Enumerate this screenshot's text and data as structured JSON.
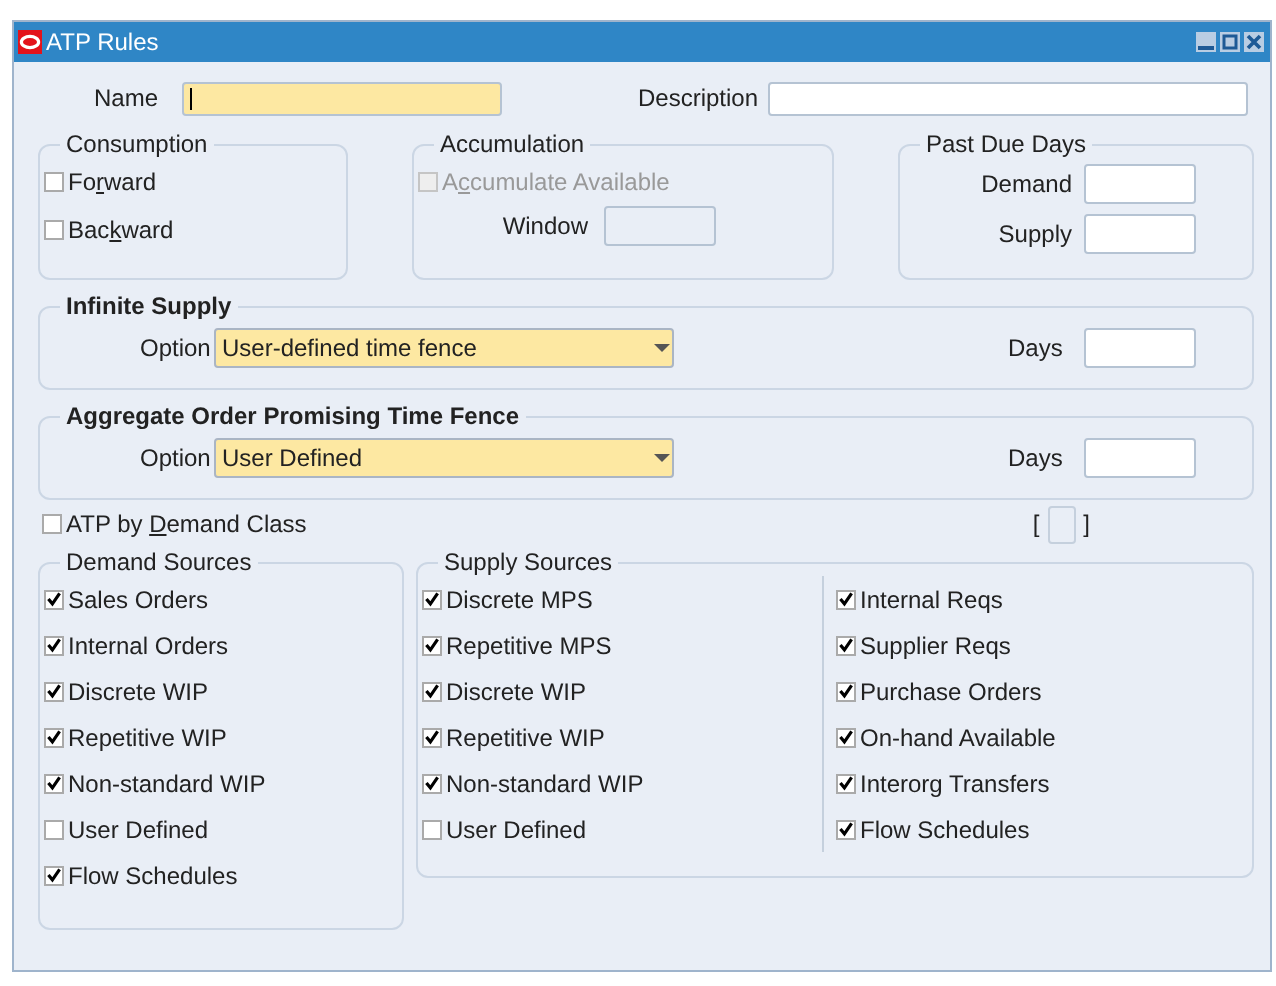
{
  "window": {
    "title": "ATP Rules"
  },
  "name": {
    "label": "Name",
    "required": true,
    "focused": true
  },
  "description": {
    "label": "Description",
    "required": false,
    "focused": false
  },
  "consumption": {
    "title": "Consumption",
    "options": [
      {
        "label_parts": [
          "Fo",
          "r",
          "ward"
        ],
        "checked": false,
        "disabled": false
      },
      {
        "label_parts": [
          "Bac",
          "k",
          "ward"
        ],
        "checked": false,
        "disabled": false
      }
    ]
  },
  "accumulation": {
    "title": "Accumulation",
    "option": {
      "label_parts": [
        "A",
        "c",
        "cumulate Available"
      ],
      "checked": false,
      "disabled": true
    },
    "window_label": "Window",
    "window_disabled": true
  },
  "past_due_days": {
    "title": "Past Due Days",
    "fields": [
      {
        "label": "Demand"
      },
      {
        "label": "Supply"
      }
    ]
  },
  "fences": [
    {
      "title": "Infinite Supply",
      "option_label": "Option",
      "option_value": "User-defined time fence",
      "days_label": "Days"
    },
    {
      "title": "Aggregate Order Promising Time Fence",
      "option_label": "Option",
      "option_value": "User Defined",
      "days_label": "Days"
    }
  ],
  "atp_by_demand_class": {
    "label_parts": [
      "ATP by ",
      "D",
      "emand Class"
    ],
    "checked": false,
    "disabled": false
  },
  "flex_field": {
    "open": "[",
    "close": "]"
  },
  "demand_sources": {
    "title": "Demand Sources",
    "items": [
      {
        "label": "Sales Orders",
        "checked": true
      },
      {
        "label": "Internal Orders",
        "checked": true
      },
      {
        "label": "Discrete WIP",
        "checked": true
      },
      {
        "label": "Repetitive WIP",
        "checked": true
      },
      {
        "label": "Non-standard WIP",
        "checked": true
      },
      {
        "label": "User Defined",
        "checked": false
      },
      {
        "label": "Flow Schedules",
        "checked": true
      }
    ]
  },
  "supply_sources": {
    "title": "Supply Sources",
    "columns": [
      [
        {
          "label": "Discrete MPS",
          "checked": true
        },
        {
          "label": "Repetitive MPS",
          "checked": true
        },
        {
          "label": "Discrete WIP",
          "checked": true
        },
        {
          "label": "Repetitive WIP",
          "checked": true
        },
        {
          "label": "Non-standard WIP",
          "checked": true
        },
        {
          "label": "User Defined",
          "checked": false
        }
      ],
      [
        {
          "label": "Internal Reqs",
          "checked": true
        },
        {
          "label": "Supplier Reqs",
          "checked": true
        },
        {
          "label": "Purchase Orders",
          "checked": true
        },
        {
          "label": "On-hand Available",
          "checked": true
        },
        {
          "label": "Interorg Transfers",
          "checked": true
        },
        {
          "label": "Flow Schedules",
          "checked": true
        }
      ]
    ]
  }
}
